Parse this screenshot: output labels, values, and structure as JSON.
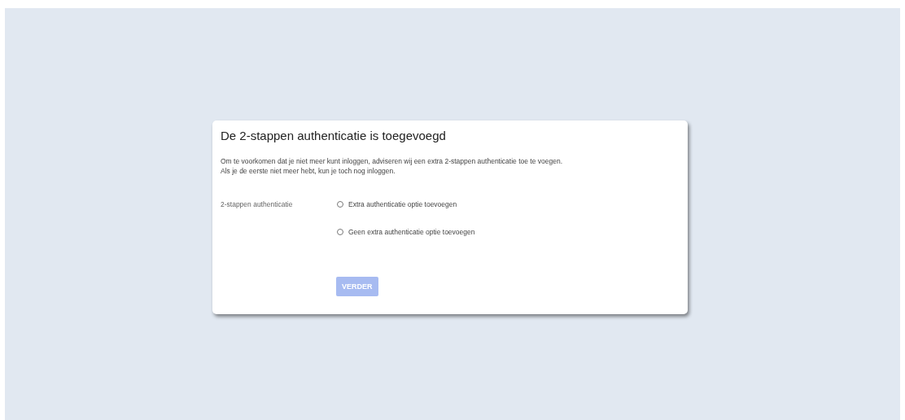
{
  "dialog": {
    "title": "De 2-stappen authenticatie is toegevoegd",
    "description": [
      "Om te voorkomen dat je niet meer kunt inloggen, adviseren wij een extra 2-stappen authenticatie toe te voegen.",
      "Als je de eerste niet meer hebt, kun je toch nog inloggen."
    ],
    "field_label": "2-stappen authenticatie",
    "options": [
      {
        "label": "Extra authenticatie optie toevoegen",
        "selected": false
      },
      {
        "label": "Geen extra authenticatie optie toevoegen",
        "selected": false
      }
    ],
    "button": {
      "label": "VERDER",
      "disabled": true
    }
  }
}
